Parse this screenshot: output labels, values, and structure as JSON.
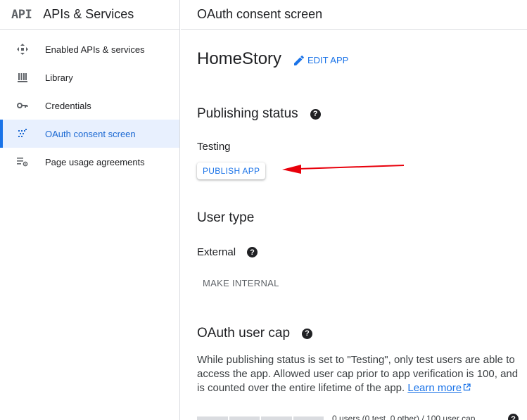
{
  "sidebar": {
    "logo": "API",
    "title": "APIs & Services",
    "items": [
      {
        "label": "Enabled APIs & services",
        "icon": "enabled-apis-icon"
      },
      {
        "label": "Library",
        "icon": "library-icon"
      },
      {
        "label": "Credentials",
        "icon": "key-icon"
      },
      {
        "label": "OAuth consent screen",
        "icon": "oauth-consent-icon",
        "active": true
      },
      {
        "label": "Page usage agreements",
        "icon": "page-usage-icon"
      }
    ]
  },
  "header": {
    "title": "OAuth consent screen"
  },
  "app": {
    "name": "HomeStory",
    "edit_label": "EDIT APP"
  },
  "publishing": {
    "title": "Publishing status",
    "status": "Testing",
    "publish_label": "PUBLISH APP"
  },
  "user_type": {
    "title": "User type",
    "value": "External",
    "make_internal_label": "MAKE INTERNAL"
  },
  "user_cap": {
    "title": "OAuth user cap",
    "text": "While publishing status is set to \"Testing\", only test users are able to access the app. Allowed user cap prior to app verification is 100, and is counted over the entire lifetime of the app.",
    "learn_more": "Learn more",
    "usage_text": "0 users (0 test, 0 other) / 100 user cap"
  },
  "colors": {
    "accent": "#1a73e8",
    "annotation_arrow": "#e8000b"
  }
}
